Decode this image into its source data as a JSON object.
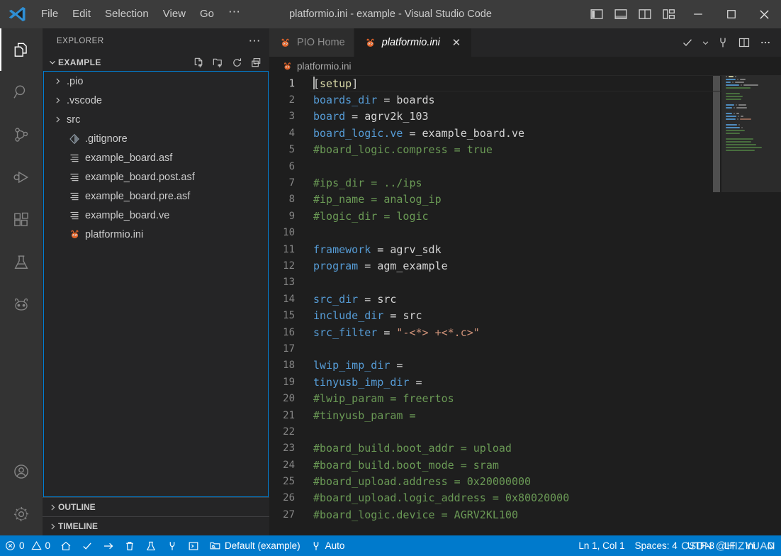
{
  "window": {
    "title": "platformio.ini - example - Visual Studio Code",
    "logo_icon": "vscode-logo",
    "minimize_label": "—",
    "maximize_label": "□",
    "close_label": "✕"
  },
  "menubar": {
    "items": [
      {
        "label": "File",
        "name": "menu-file"
      },
      {
        "label": "Edit",
        "name": "menu-edit"
      },
      {
        "label": "Selection",
        "name": "menu-selection"
      },
      {
        "label": "View",
        "name": "menu-view"
      },
      {
        "label": "Go",
        "name": "menu-go"
      }
    ],
    "overflow_label": "⋯"
  },
  "layout_controls": [
    {
      "name": "toggle-primary-sidebar-icon",
      "title": "Toggle Primary Side Bar"
    },
    {
      "name": "toggle-panel-icon",
      "title": "Toggle Panel"
    },
    {
      "name": "toggle-secondary-sidebar-icon",
      "title": "Toggle Secondary Side Bar"
    },
    {
      "name": "customize-layout-icon",
      "title": "Customize Layout"
    }
  ],
  "activitybar": {
    "items": [
      {
        "name": "activity-explorer",
        "icon": "files-icon",
        "label": "Explorer",
        "active": true
      },
      {
        "name": "activity-search",
        "icon": "search-icon",
        "label": "Search",
        "active": false
      },
      {
        "name": "activity-source-control",
        "icon": "source-control-icon",
        "label": "Source Control",
        "active": false
      },
      {
        "name": "activity-run-debug",
        "icon": "run-and-debug-icon",
        "label": "Run and Debug",
        "active": false
      },
      {
        "name": "activity-extensions",
        "icon": "extensions-icon",
        "label": "Extensions",
        "active": false
      },
      {
        "name": "activity-testing",
        "icon": "beaker-icon",
        "label": "Testing",
        "active": false
      },
      {
        "name": "activity-platformio",
        "icon": "platformio-alien-icon",
        "label": "PlatformIO",
        "active": false
      }
    ],
    "bottom": [
      {
        "name": "activity-accounts",
        "icon": "account-icon",
        "label": "Accounts"
      },
      {
        "name": "activity-settings",
        "icon": "gear-icon",
        "label": "Manage"
      }
    ]
  },
  "sidebar": {
    "title": "EXPLORER",
    "more_actions_label": "⋯",
    "folder": {
      "name": "EXAMPLE",
      "expanded": true,
      "actions": [
        {
          "name": "new-file-icon",
          "label": "New File"
        },
        {
          "name": "new-folder-icon",
          "label": "New Folder"
        },
        {
          "name": "refresh-explorer-icon",
          "label": "Refresh Explorer"
        },
        {
          "name": "collapse-folders-icon",
          "label": "Collapse Folders"
        }
      ]
    },
    "tree": [
      {
        "label": ".pio",
        "type": "folder",
        "icon": "chevron-right-icon",
        "expanded": false
      },
      {
        "label": ".vscode",
        "type": "folder",
        "icon": "chevron-right-icon",
        "expanded": false
      },
      {
        "label": "src",
        "type": "folder",
        "icon": "chevron-right-icon",
        "expanded": false
      },
      {
        "label": ".gitignore",
        "type": "file",
        "icon": "git-icon"
      },
      {
        "label": "example_board.asf",
        "type": "file",
        "icon": "settings-file-icon"
      },
      {
        "label": "example_board.post.asf",
        "type": "file",
        "icon": "settings-file-icon"
      },
      {
        "label": "example_board.pre.asf",
        "type": "file",
        "icon": "settings-file-icon"
      },
      {
        "label": "example_board.ve",
        "type": "file",
        "icon": "settings-file-icon"
      },
      {
        "label": "platformio.ini",
        "type": "file",
        "icon": "platformio-file-icon"
      }
    ],
    "panels": [
      {
        "label": "OUTLINE",
        "name": "panel-outline",
        "expanded": false
      },
      {
        "label": "TIMELINE",
        "name": "panel-timeline",
        "expanded": false
      }
    ]
  },
  "editor": {
    "tabs": [
      {
        "label": "PIO Home",
        "icon": "platformio-icon",
        "active": false,
        "italic": false,
        "closable": false
      },
      {
        "label": "platformio.ini",
        "icon": "platformio-icon",
        "active": true,
        "italic": true,
        "closable": true,
        "close_label": "✕"
      }
    ],
    "tab_actions": [
      {
        "name": "platformio-build-icon",
        "label": "PlatformIO: Build"
      },
      {
        "name": "chevron-down-icon",
        "label": "More build actions"
      },
      {
        "name": "serial-monitor-icon",
        "label": "PlatformIO: Serial Monitor"
      },
      {
        "name": "split-editor-icon",
        "label": "Split Editor Right"
      },
      {
        "name": "editor-more-actions-icon",
        "label": "More Actions..."
      }
    ],
    "breadcrumb": {
      "icon": "platformio-icon",
      "label": "platformio.ini"
    },
    "lines": [
      {
        "n": 1,
        "tokens": [
          {
            "t": "punct",
            "v": "["
          },
          {
            "t": "section",
            "v": "setup"
          },
          {
            "t": "punct",
            "v": "]"
          }
        ],
        "current": true
      },
      {
        "n": 2,
        "tokens": [
          {
            "t": "key",
            "v": "boards_dir"
          },
          {
            "t": "op",
            "v": " = "
          },
          {
            "t": "val",
            "v": "boards"
          }
        ]
      },
      {
        "n": 3,
        "tokens": [
          {
            "t": "key",
            "v": "board"
          },
          {
            "t": "op",
            "v": " = "
          },
          {
            "t": "val",
            "v": "agrv2k_103"
          }
        ]
      },
      {
        "n": 4,
        "tokens": [
          {
            "t": "key",
            "v": "board_logic.ve"
          },
          {
            "t": "op",
            "v": " = "
          },
          {
            "t": "val",
            "v": "example_board.ve"
          }
        ]
      },
      {
        "n": 5,
        "tokens": [
          {
            "t": "comment",
            "v": "#board_logic.compress = true"
          }
        ]
      },
      {
        "n": 6,
        "tokens": []
      },
      {
        "n": 7,
        "tokens": [
          {
            "t": "comment",
            "v": "#ips_dir = ../ips"
          }
        ]
      },
      {
        "n": 8,
        "tokens": [
          {
            "t": "comment",
            "v": "#ip_name = analog_ip"
          }
        ]
      },
      {
        "n": 9,
        "tokens": [
          {
            "t": "comment",
            "v": "#logic_dir = logic"
          }
        ]
      },
      {
        "n": 10,
        "tokens": []
      },
      {
        "n": 11,
        "tokens": [
          {
            "t": "key",
            "v": "framework"
          },
          {
            "t": "op",
            "v": " = "
          },
          {
            "t": "val",
            "v": "agrv_sdk"
          }
        ]
      },
      {
        "n": 12,
        "tokens": [
          {
            "t": "key",
            "v": "program"
          },
          {
            "t": "op",
            "v": " = "
          },
          {
            "t": "val",
            "v": "agm_example"
          }
        ]
      },
      {
        "n": 13,
        "tokens": []
      },
      {
        "n": 14,
        "tokens": [
          {
            "t": "key",
            "v": "src_dir"
          },
          {
            "t": "op",
            "v": " = "
          },
          {
            "t": "val",
            "v": "src"
          }
        ]
      },
      {
        "n": 15,
        "tokens": [
          {
            "t": "key",
            "v": "include_dir"
          },
          {
            "t": "op",
            "v": " = "
          },
          {
            "t": "val",
            "v": "src"
          }
        ]
      },
      {
        "n": 16,
        "tokens": [
          {
            "t": "key",
            "v": "src_filter"
          },
          {
            "t": "op",
            "v": " = "
          },
          {
            "t": "string",
            "v": "\"-<*> +<*.c>\""
          }
        ]
      },
      {
        "n": 17,
        "tokens": []
      },
      {
        "n": 18,
        "tokens": [
          {
            "t": "key",
            "v": "lwip_imp_dir"
          },
          {
            "t": "op",
            "v": " ="
          }
        ]
      },
      {
        "n": 19,
        "tokens": [
          {
            "t": "key",
            "v": "tinyusb_imp_dir"
          },
          {
            "t": "op",
            "v": " ="
          }
        ]
      },
      {
        "n": 20,
        "tokens": [
          {
            "t": "comment",
            "v": "#lwip_param = freertos"
          }
        ]
      },
      {
        "n": 21,
        "tokens": [
          {
            "t": "comment",
            "v": "#tinyusb_param ="
          }
        ]
      },
      {
        "n": 22,
        "tokens": []
      },
      {
        "n": 23,
        "tokens": [
          {
            "t": "comment",
            "v": "#board_build.boot_addr = upload"
          }
        ]
      },
      {
        "n": 24,
        "tokens": [
          {
            "t": "comment",
            "v": "#board_build.boot_mode = sram"
          }
        ]
      },
      {
        "n": 25,
        "tokens": [
          {
            "t": "comment",
            "v": "#board_upload.address = 0x20000000"
          }
        ]
      },
      {
        "n": 26,
        "tokens": [
          {
            "t": "comment",
            "v": "#board_upload.logic_address = 0x80020000"
          }
        ]
      },
      {
        "n": 27,
        "tokens": [
          {
            "t": "comment",
            "v": "#board_logic.device = AGRV2KL100"
          }
        ]
      }
    ]
  },
  "statusbar": {
    "left": [
      {
        "name": "status-problems",
        "icon": "error-icon",
        "label": "0",
        "second_icon": "warning-icon",
        "second_label": "0"
      },
      {
        "name": "status-pio-home",
        "icon": "home-icon",
        "label": ""
      },
      {
        "name": "status-pio-build",
        "icon": "check-icon",
        "label": ""
      },
      {
        "name": "status-pio-upload",
        "icon": "arrow-right-icon",
        "label": ""
      },
      {
        "name": "status-pio-clean",
        "icon": "trash-icon",
        "label": ""
      },
      {
        "name": "status-pio-test",
        "icon": "beaker-icon",
        "label": ""
      },
      {
        "name": "status-pio-serial-monitor",
        "icon": "plug-icon",
        "label": ""
      },
      {
        "name": "status-new-terminal",
        "icon": "terminal-icon",
        "label": ""
      },
      {
        "name": "status-pio-env",
        "icon": "folder-env-icon",
        "label": "Default (example)"
      },
      {
        "name": "status-pio-port",
        "icon": "plug-icon",
        "label": "Auto"
      }
    ],
    "right": [
      {
        "name": "status-cursor-position",
        "label": "Ln 1, Col 1"
      },
      {
        "name": "status-indentation",
        "label": "Spaces: 4"
      },
      {
        "name": "status-encoding",
        "label": "UTF-8"
      },
      {
        "name": "status-eol",
        "label": "LF"
      },
      {
        "name": "status-language-mode",
        "label": "Ini"
      },
      {
        "name": "status-notifications",
        "icon": "bell-icon",
        "label": ""
      }
    ],
    "watermark": "CSDN @HIZYUAN"
  },
  "colors": {
    "accent": "#007acc",
    "titlebar_bg": "#3c3c3c",
    "activitybar_bg": "#333333",
    "sidebar_bg": "#252526",
    "editor_bg": "#1e1e1e",
    "selection_border": "#007fd4",
    "section_token": "#dcdcaa",
    "key_token": "#569cd6",
    "comment_token": "#6a9955",
    "string_token": "#ce9178",
    "platformio_orange": "#e2642a"
  }
}
